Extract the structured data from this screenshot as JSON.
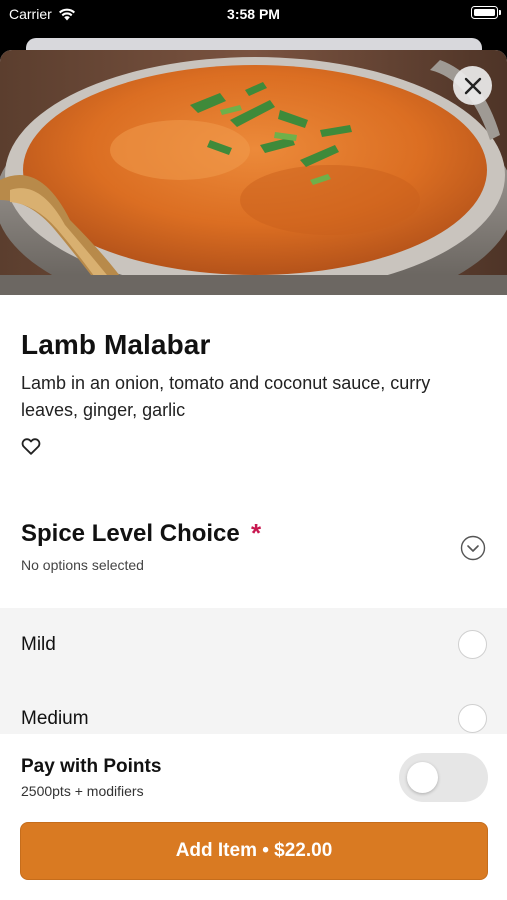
{
  "status_bar": {
    "carrier": "Carrier",
    "time": "3:58 PM",
    "icons": [
      "wifi-icon",
      "battery-icon"
    ]
  },
  "item": {
    "image_icon": "dish-photo",
    "title": "Lamb Malabar",
    "description": "Lamb in an onion, tomato and coconut sauce, curry leaves, ginger, garlic",
    "favorite_icon": "heart-outline-icon",
    "favorited": false
  },
  "close_icon": "close-icon",
  "modifier_group": {
    "title": "Spice Level Choice",
    "required_mark": "*",
    "subtitle": "No options selected",
    "expand_icon": "chevron-down-circle-icon",
    "options": [
      {
        "label": "Mild",
        "selected": false
      },
      {
        "label": "Medium",
        "selected": false
      }
    ]
  },
  "points": {
    "title": "Pay with Points",
    "subtitle": "2500pts + modifiers",
    "enabled": false
  },
  "add_button": {
    "label": "Add Item • $22.00"
  },
  "colors": {
    "accent": "#d97a22",
    "required": "#c8174f",
    "options_bg": "#f4f4f4"
  }
}
